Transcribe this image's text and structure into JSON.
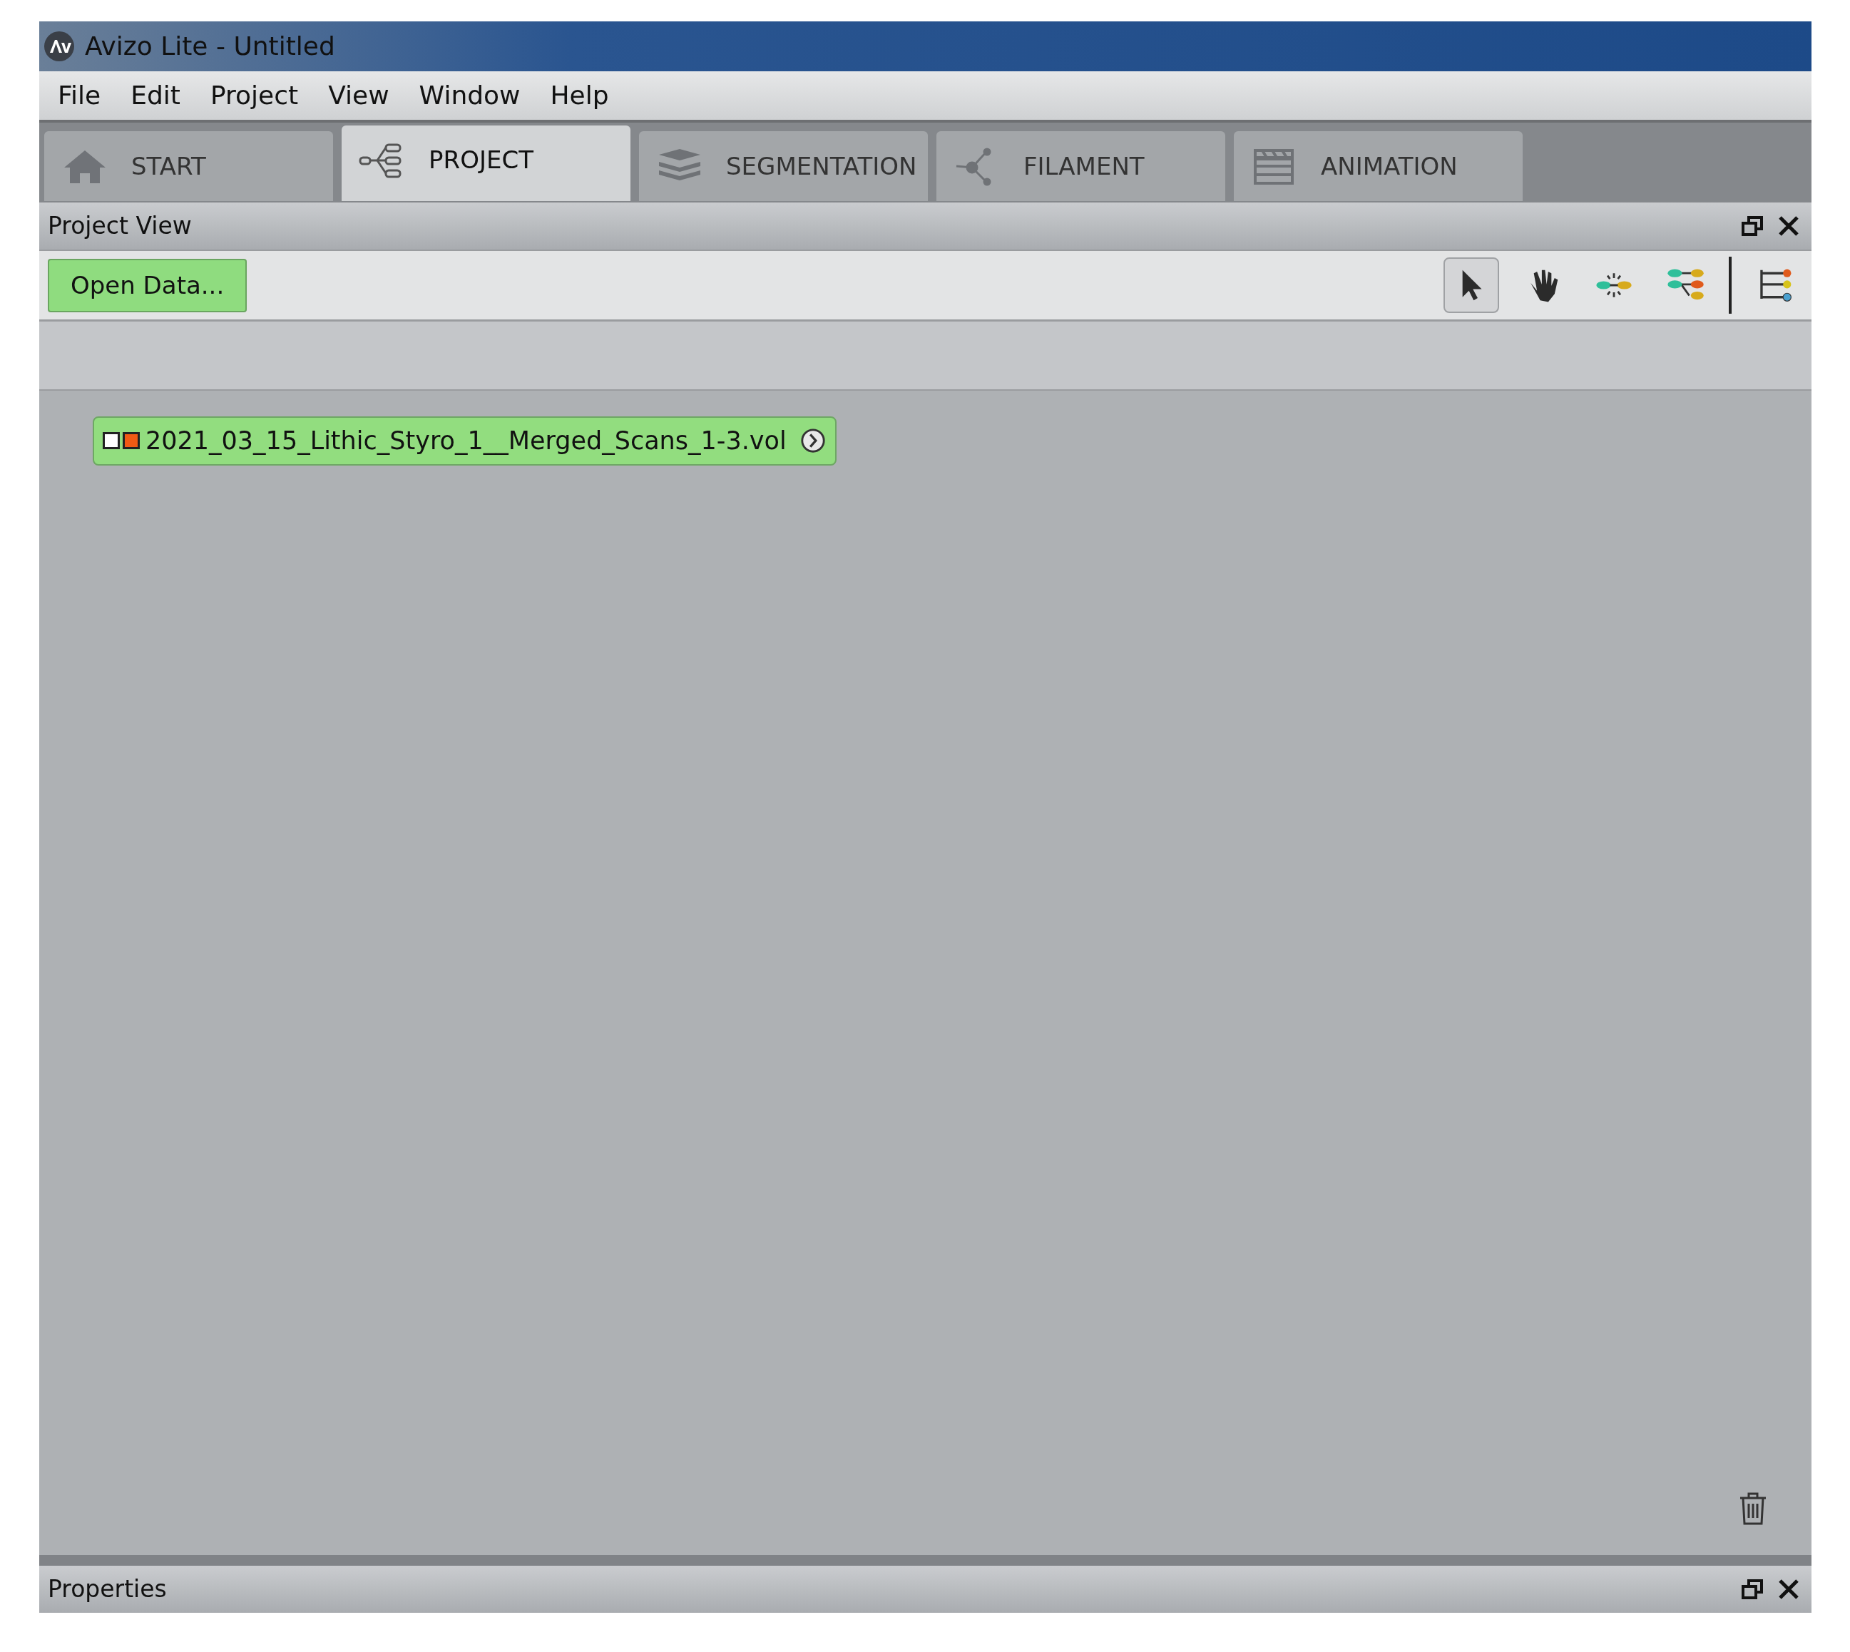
{
  "window": {
    "title": "Avizo Lite - Untitled"
  },
  "menu": [
    "File",
    "Edit",
    "Project",
    "View",
    "Window",
    "Help"
  ],
  "tabs": [
    {
      "label": "START",
      "kind": "home",
      "selected": false
    },
    {
      "label": "PROJECT",
      "kind": "graph",
      "selected": true
    },
    {
      "label": "SEGMENTATION",
      "kind": "layers",
      "selected": false
    },
    {
      "label": "FILAMENT",
      "kind": "filament",
      "selected": false
    },
    {
      "label": "ANIMATION",
      "kind": "clapper",
      "selected": false
    }
  ],
  "project_view": {
    "title": "Project View",
    "open_data_button": "Open Data...",
    "tools": [
      {
        "kind": "pointer",
        "selected": true
      },
      {
        "kind": "hand",
        "selected": false
      },
      {
        "kind": "connect",
        "selected": false
      },
      {
        "kind": "tree",
        "selected": false
      },
      {
        "kind": "divider"
      },
      {
        "kind": "list",
        "selected": false
      }
    ],
    "data_node": {
      "label": "2021_03_15_Lithic_Styro_1__Merged_Scans_1-3.vol",
      "ports": [
        {
          "color": "#ffffff"
        },
        {
          "color": "#f05a14"
        }
      ]
    }
  },
  "properties": {
    "title": "Properties"
  }
}
